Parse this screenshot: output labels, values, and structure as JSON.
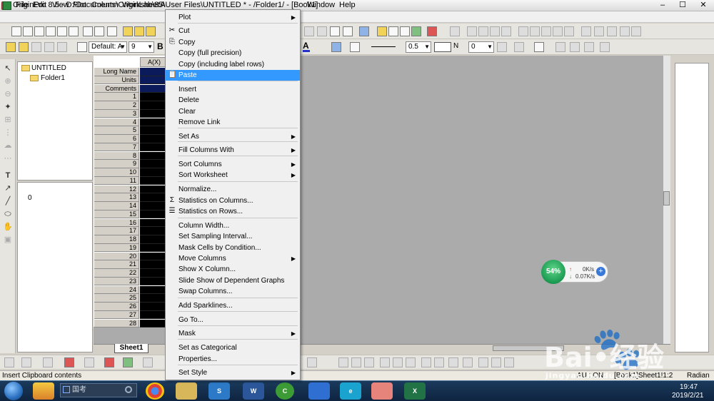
{
  "window": {
    "title": "OriginPro 8.5 - D:\\Documents\\OriginLab\\85\\User Files\\UNTITLED * - /Folder1/ - [Book1]",
    "controls": [
      "–",
      "☐",
      "✕"
    ]
  },
  "menubar": {
    "items": [
      "File",
      "Edit",
      "View",
      "Plot",
      "Column",
      "Worksheet",
      "A",
      "Window",
      "Help"
    ]
  },
  "toolbar_format": {
    "font_combo": "Default: A",
    "size_combo": "9",
    "bold": "B",
    "font_color_letter": "A",
    "line_width_combo": "0.5",
    "n_label": "N",
    "zero_combo": "0"
  },
  "project_explorer": {
    "root": "UNTITLED",
    "child": "Folder1",
    "lower_value": "0"
  },
  "worksheet": {
    "column_header": "A(X)",
    "label_rows": [
      "Long Name",
      "Units",
      "Comments"
    ],
    "row_numbers": [
      "1",
      "2",
      "3",
      "4",
      "5",
      "6",
      "7",
      "8",
      "9",
      "10",
      "11",
      "12",
      "13",
      "14",
      "15",
      "16",
      "17",
      "18",
      "19",
      "20",
      "21",
      "22",
      "23",
      "24",
      "25",
      "26",
      "27",
      "28"
    ],
    "sheet_tab": "Sheet1"
  },
  "context_menu": {
    "items": [
      {
        "label": "Plot",
        "submenu": true
      },
      {
        "label": "Cut",
        "icon": "scissors-icon"
      },
      {
        "label": "Copy",
        "icon": "copy-icon"
      },
      {
        "label": "Copy (full precision)"
      },
      {
        "label": "Copy (including label rows)"
      },
      {
        "label": "Paste",
        "icon": "paste-icon",
        "highlighted": true
      },
      {
        "label": "Insert"
      },
      {
        "label": "Delete"
      },
      {
        "label": "Clear"
      },
      {
        "label": "Remove Link"
      },
      {
        "label": "Set As",
        "submenu": true
      },
      {
        "label": "Fill Columns With",
        "submenu": true
      },
      {
        "label": "Sort Columns",
        "submenu": true
      },
      {
        "label": "Sort Worksheet",
        "submenu": true
      },
      {
        "label": "Normalize..."
      },
      {
        "label": "Statistics on Columns...",
        "icon": "sigma-icon"
      },
      {
        "label": "Statistics on Rows...",
        "icon": "stats-rows-icon"
      },
      {
        "label": "Column Width..."
      },
      {
        "label": "Set Sampling Interval..."
      },
      {
        "label": "Mask Cells by Condition..."
      },
      {
        "label": "Move Columns",
        "submenu": true
      },
      {
        "label": "Show X Column..."
      },
      {
        "label": "Slide Show of Dependent Graphs"
      },
      {
        "label": "Swap Columns..."
      },
      {
        "label": "Add Sparklines..."
      },
      {
        "label": "Go To..."
      },
      {
        "label": "Mask",
        "submenu": true
      },
      {
        "label": "Set as Categorical"
      },
      {
        "label": "Properties..."
      },
      {
        "label": "Set Style",
        "submenu": true
      }
    ]
  },
  "statusbar": {
    "left": "Insert Clipboard contents",
    "middle": "AU : ON",
    "book": "[Book1]Sheet1!1:2",
    "right": "Radian"
  },
  "net_widget": {
    "percent": "54%",
    "up": "0K/s",
    "down": "0.07K/s"
  },
  "taskbar": {
    "search_placeholder": "国考",
    "time": "19:47",
    "date": "2019/2/21"
  },
  "watermark": {
    "text": "Bai•经验",
    "url": "jingyan.baidu.com"
  },
  "colors": {
    "menu_highlight": "#3399ff",
    "cell_fill": "#000000",
    "workspace": "#ababab"
  }
}
